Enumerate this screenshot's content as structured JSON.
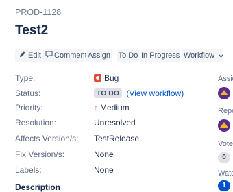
{
  "issue": {
    "key": "PROD-1128",
    "summary": "Test2"
  },
  "toolbar": {
    "edit": "Edit",
    "comment": "Comment",
    "assign": "Assign",
    "todo": "To Do",
    "in_progress": "In Progress",
    "workflow": "Workflow"
  },
  "details": {
    "type_label": "Type:",
    "type_value": "Bug",
    "status_label": "Status:",
    "status_value": "TO DO",
    "status_link": "(View workflow)",
    "priority_label": "Priority:",
    "priority_value": "Medium",
    "resolution_label": "Resolution:",
    "resolution_value": "Unresolved",
    "affects_label": "Affects Version/s:",
    "affects_value": "TestRelease",
    "fix_label": "Fix Version/s:",
    "fix_value": "None",
    "labels_label": "Labels:",
    "labels_value": "None"
  },
  "sidebar": {
    "assignee_label": "Assig",
    "reporter_label": "Repo",
    "votes_label": "Vote",
    "votes_count": "0",
    "watchers_label": "Watc",
    "watchers_count": "1"
  },
  "description_heading": "Description",
  "colors": {
    "bug": "#e5493a",
    "link": "#0052cc",
    "priority": "#ff7452",
    "badge": "#0052cc"
  }
}
